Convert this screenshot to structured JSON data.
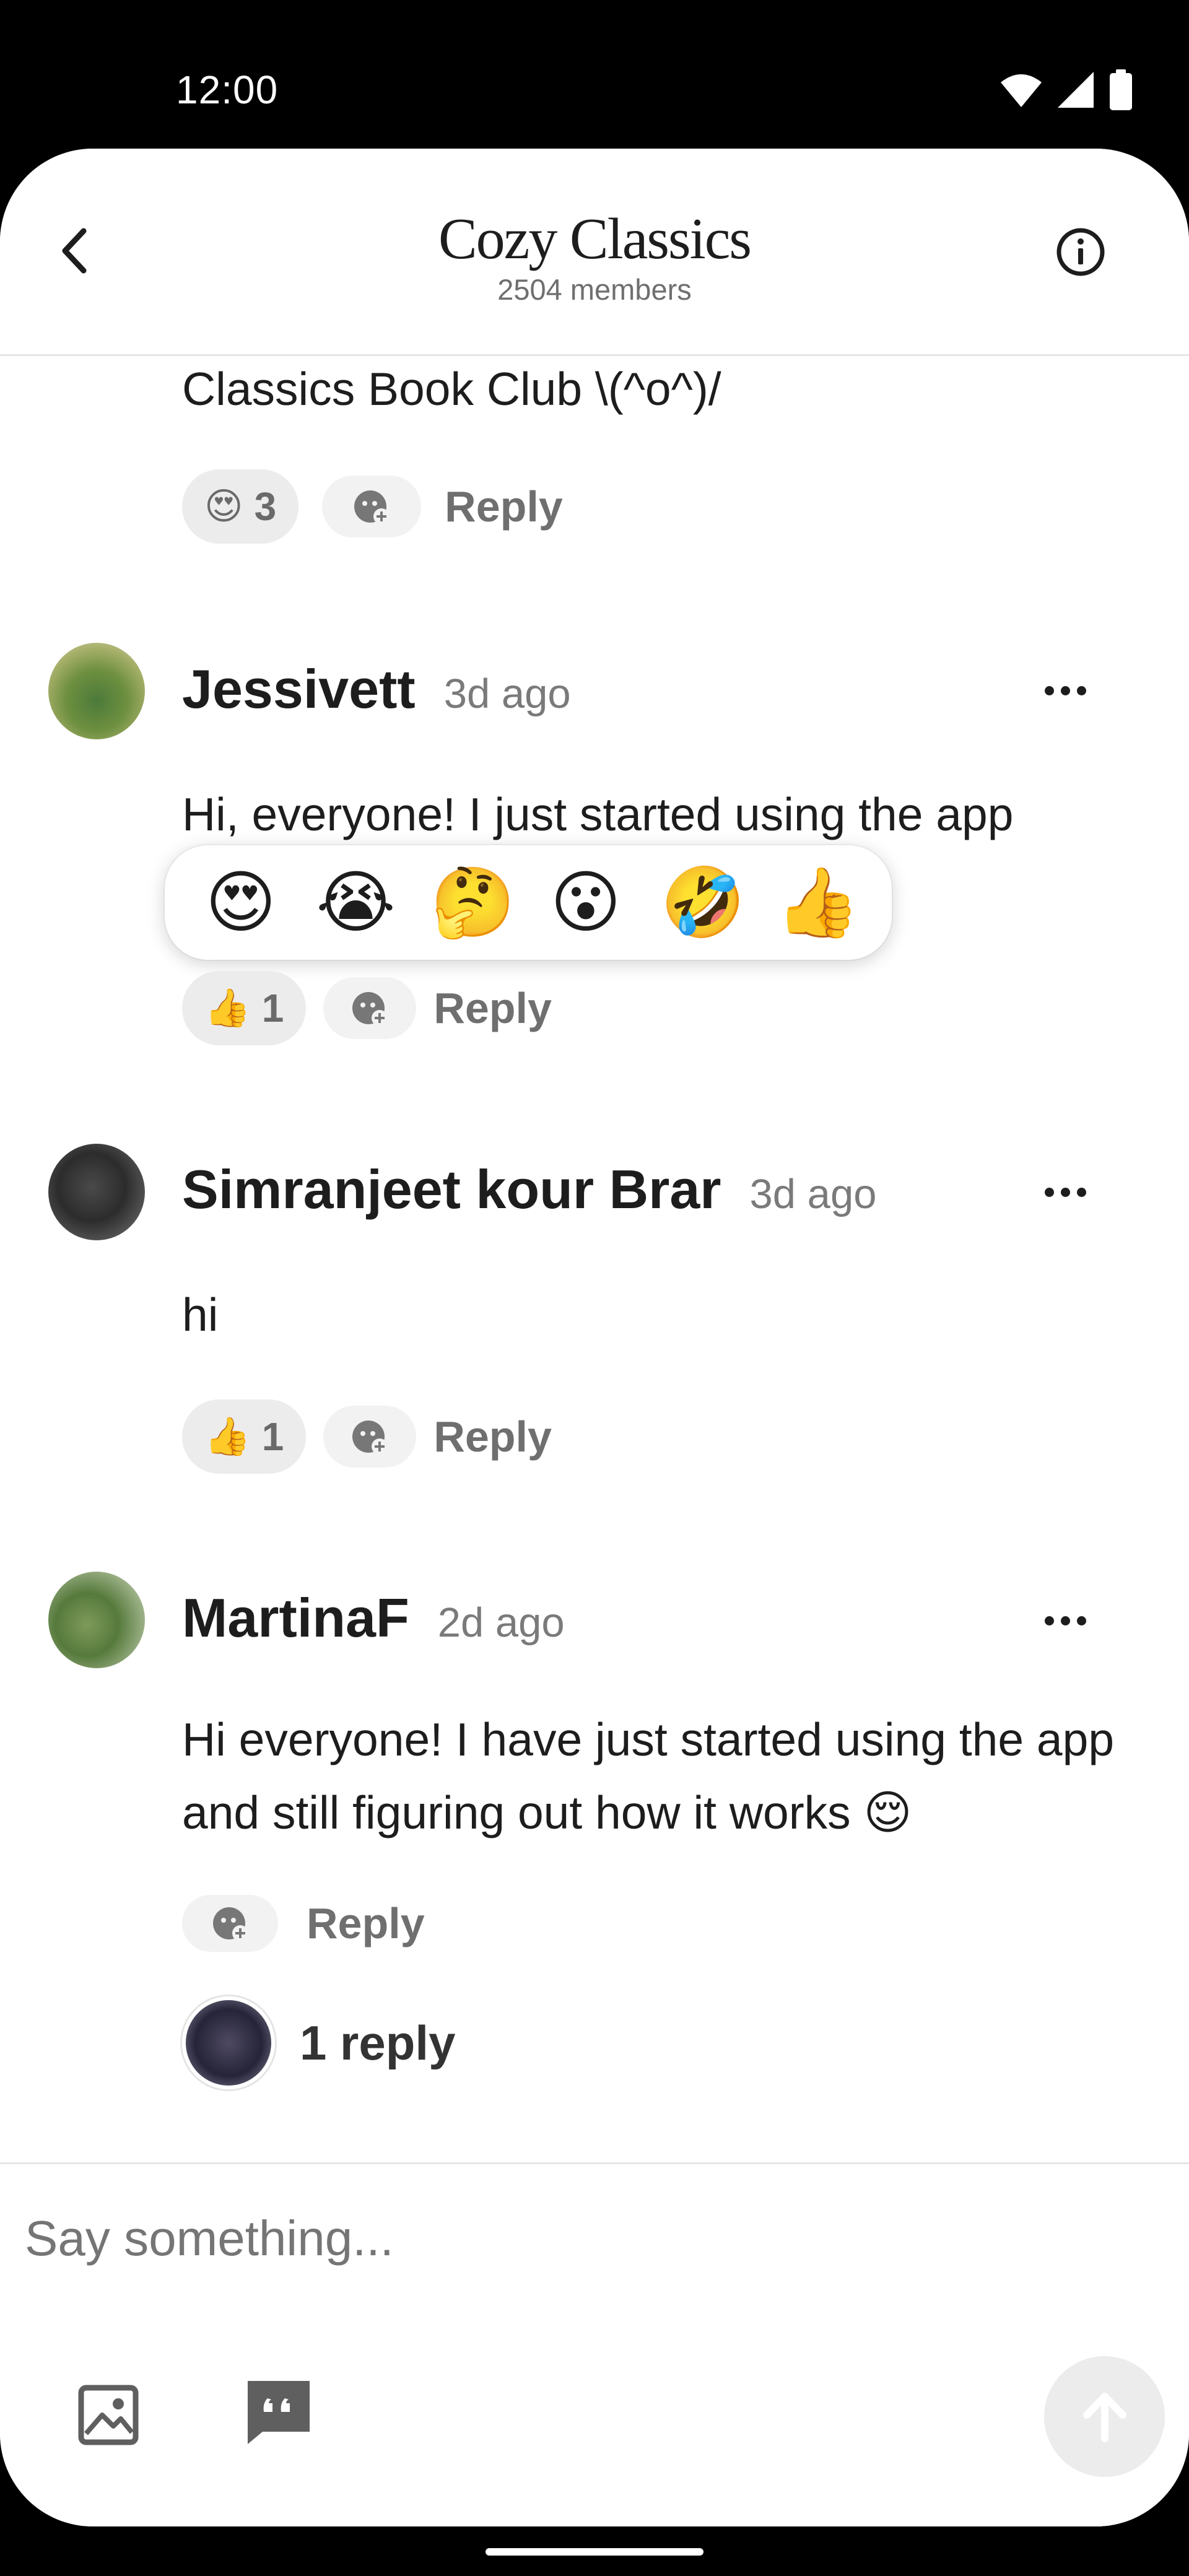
{
  "status_bar": {
    "time": "12:00"
  },
  "header": {
    "title": "Cozy Classics",
    "members": "2504 members"
  },
  "top_message": {
    "text_tail": "Classics Book Club \\(^o^)/",
    "reaction_emoji": "😍",
    "reaction_count": "3",
    "reply_label": "Reply"
  },
  "messages": [
    {
      "username": "Jessivett",
      "time": "3d ago",
      "text": "Hi, everyone! I just started using the app",
      "reaction_emoji": "👍",
      "reaction_count": "1",
      "reply_label": "Reply"
    },
    {
      "username": "Simranjeet kour Brar",
      "time": "3d ago",
      "text": "hi",
      "reaction_emoji": "👍",
      "reaction_count": "1",
      "reply_label": "Reply"
    },
    {
      "username": "MartinaF",
      "time": "2d ago",
      "text": "Hi everyone! I have just started using the app and still figuring out how it works 😌",
      "reply_label": "Reply",
      "replies_label": "1 reply"
    }
  ],
  "emoji_picker": {
    "emojis": [
      "😍",
      "😭",
      "🤔",
      "😮",
      "🤣",
      "👍"
    ]
  },
  "composer": {
    "placeholder": "Say something..."
  },
  "colors": {
    "accent_bg": "#ececec",
    "muted_text": "#6f6f6f",
    "primary_text": "#1d1d1d"
  },
  "icons": [
    "back-arrow-icon",
    "info-icon",
    "more-dots-icon",
    "add-reaction-icon",
    "image-icon",
    "quote-icon",
    "send-arrow-icon"
  ]
}
